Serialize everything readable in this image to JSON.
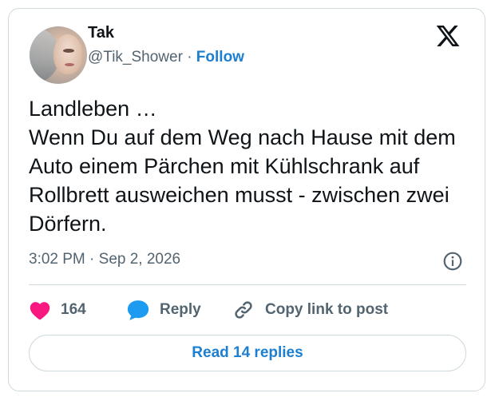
{
  "author": {
    "name": "Tak",
    "handle": "@Tik_Shower",
    "separator": "·",
    "follow_label": "Follow"
  },
  "brand": {
    "logo_icon": "x-logo-icon",
    "color": "#0f1419"
  },
  "tweet": {
    "text": "Landleben …\nWenn Du auf dem Weg nach Hause mit dem Auto einem Pärchen mit Kühlschrank auf Rollbrett ausweichen musst - zwischen zwei Dörfern.",
    "timestamp": "3:02 PM · Sep 2, 2026",
    "info_icon": "info-icon"
  },
  "actions": {
    "likes": {
      "icon": "heart-icon",
      "count": "164",
      "color": "#f91880"
    },
    "reply": {
      "icon": "speech-bubble-icon",
      "label": "Reply",
      "color": "#1d9bf0"
    },
    "copy": {
      "icon": "link-icon",
      "label": "Copy link to post"
    }
  },
  "replies_button": {
    "label": "Read 14 replies"
  },
  "colors": {
    "accent": "#1d7fd1",
    "muted": "#536471",
    "border": "#cfd9de"
  }
}
